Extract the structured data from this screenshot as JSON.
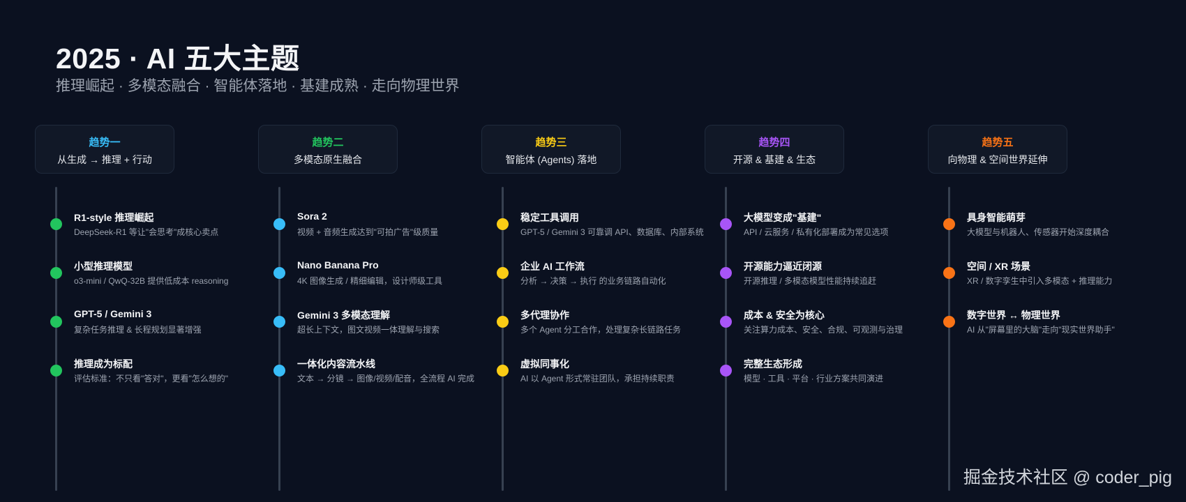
{
  "header": {
    "title": "2025 · AI 五大主题",
    "subtitle": "推理崛起 · 多模态融合 · 智能体落地 · 基建成熟 · 走向物理世界"
  },
  "colors": {
    "background": "#0b1120",
    "trend1": "#22d3ee",
    "trend2": "#22c55e",
    "trend3": "#facc15",
    "trend4": "#a855f7",
    "trend5": "#f97316",
    "dot1": "#22c55e",
    "dot2": "#38bdf8",
    "dot3": "#facc15",
    "dot4": "#a855f7",
    "dot5": "#f97316"
  },
  "columns": [
    {
      "trend": "趋势一",
      "topic": "从生成 → 推理 + 行动",
      "items": [
        {
          "title": "R1-style 推理崛起",
          "desc": "DeepSeek-R1 等让\"会思考\"成核心卖点"
        },
        {
          "title": "小型推理模型",
          "desc": "o3-mini / QwQ-32B 提供低成本 reasoning"
        },
        {
          "title": "GPT-5 / Gemini 3",
          "desc": "复杂任务推理 & 长程规划显著增强"
        },
        {
          "title": "推理成为标配",
          "desc": "评估标准：不只看\"答对\"，更看\"怎么想的\""
        }
      ]
    },
    {
      "trend": "趋势二",
      "topic": "多模态原生融合",
      "items": [
        {
          "title": "Sora 2",
          "desc": "视频 + 音频生成达到\"可拍广告\"级质量"
        },
        {
          "title": "Nano Banana Pro",
          "desc": "4K 图像生成 / 精细编辑，设计师级工具"
        },
        {
          "title": "Gemini 3 多模态理解",
          "desc": "超长上下文，图文视频一体理解与搜索"
        },
        {
          "title": "一体化内容流水线",
          "desc": "文本 → 分镜 → 图像/视频/配音，全流程 AI 完成"
        }
      ]
    },
    {
      "trend": "趋势三",
      "topic": "智能体 (Agents) 落地",
      "items": [
        {
          "title": "稳定工具调用",
          "desc": "GPT-5 / Gemini 3 可靠调 API、数据库、内部系统"
        },
        {
          "title": "企业 AI 工作流",
          "desc": "分析 → 决策 → 执行 的业务链路自动化"
        },
        {
          "title": "多代理协作",
          "desc": "多个 Agent 分工合作，处理复杂长链路任务"
        },
        {
          "title": "虚拟同事化",
          "desc": "AI 以 Agent 形式常驻团队，承担持续职责"
        }
      ]
    },
    {
      "trend": "趋势四",
      "topic": "开源 & 基建 & 生态",
      "items": [
        {
          "title": "大模型变成\"基建\"",
          "desc": "API / 云服务 / 私有化部署成为常见选项"
        },
        {
          "title": "开源能力逼近闭源",
          "desc": "开源推理 / 多模态模型性能持续追赶"
        },
        {
          "title": "成本 & 安全为核心",
          "desc": "关注算力成本、安全、合规、可观测与治理"
        },
        {
          "title": "完整生态形成",
          "desc": "模型 · 工具 · 平台 · 行业方案共同演进"
        }
      ]
    },
    {
      "trend": "趋势五",
      "topic": "向物理 & 空间世界延伸",
      "items": [
        {
          "title": "具身智能萌芽",
          "desc": "大模型与机器人、传感器开始深度耦合"
        },
        {
          "title": "空间 / XR 场景",
          "desc": "XR / 数字孪生中引入多模态 + 推理能力"
        },
        {
          "title": "数字世界 ↔ 物理世界",
          "desc": "AI 从\"屏幕里的大脑\"走向\"现实世界助手\""
        }
      ]
    }
  ],
  "watermark": "掘金技术社区 @ coder_pig"
}
